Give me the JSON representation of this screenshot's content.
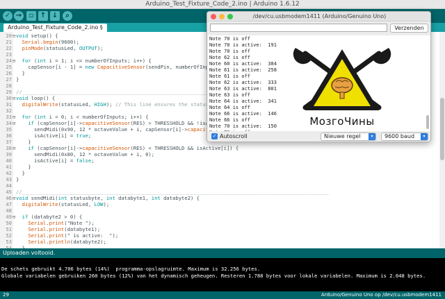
{
  "ide": {
    "title": "Arduino_Test_Fixture_Code_2.ino | Arduino 1.6.12",
    "toolbar_icons": [
      "verify-icon",
      "upload-icon",
      "new-icon",
      "open-icon",
      "save-icon",
      "serial-monitor-icon"
    ],
    "tab_label": "Arduino_Test_Fixture_Code_2.ino §",
    "code_lines": [
      {
        "n": "20",
        "fold": "⊟",
        "text": "void setup() {"
      },
      {
        "n": "21",
        "fold": "",
        "text": "  Serial.begin(9600);"
      },
      {
        "n": "22",
        "fold": "",
        "text": "  pinMode(statusLed, OUTPUT);"
      },
      {
        "n": "23",
        "fold": "",
        "text": ""
      },
      {
        "n": "24",
        "fold": "⊟",
        "text": "  for (int i = 1; i <= numberOfInputs; i++) {"
      },
      {
        "n": "25",
        "fold": "",
        "text": "    capSensor[i - 1] = new CapacitiveSensor(sendPin, numberOfInputs + first"
      },
      {
        "n": "26",
        "fold": "",
        "text": "  }"
      },
      {
        "n": "27",
        "fold": "",
        "text": "}"
      },
      {
        "n": "28",
        "fold": "",
        "text": ""
      },
      {
        "n": "29",
        "fold": "",
        "text": "//______________________________________________________________________________________________________"
      },
      {
        "n": "30",
        "fold": "⊟",
        "text": "void loop() {"
      },
      {
        "n": "31",
        "fold": "",
        "text": "  digitalWrite(statusLed, HIGH); // This line ensures the status LED gets "
      },
      {
        "n": "32",
        "fold": "",
        "text": ""
      },
      {
        "n": "33",
        "fold": "⊟",
        "text": "  for (int i = 0; i < numberOfInputs; i++) {"
      },
      {
        "n": "34",
        "fold": "⊟",
        "text": "    if (capSensor[i]->capacitiveSensor(RES) > THRESSHOLD && !isActive[i] )"
      },
      {
        "n": "35",
        "fold": "",
        "text": "      sendMidi(0x90, 12 * octaveValue + i, capSensor[i]->capacitiveSensor(R"
      },
      {
        "n": "36",
        "fold": "",
        "text": "      isActive[i] = true;"
      },
      {
        "n": "37",
        "fold": "",
        "text": "    }"
      },
      {
        "n": "38",
        "fold": "⊟",
        "text": "    if (capSensor[i]->capacitiveSensor(RES) < THRESSHOLD && isActive[i]) {"
      },
      {
        "n": "39",
        "fold": "",
        "text": "      sendMidi(0x80, 12 * octaveValue + i, 0);"
      },
      {
        "n": "40",
        "fold": "",
        "text": "      isActive[i] = false;"
      },
      {
        "n": "41",
        "fold": "",
        "text": "    }"
      },
      {
        "n": "42",
        "fold": "",
        "text": "  }"
      },
      {
        "n": "43",
        "fold": "",
        "text": "}"
      },
      {
        "n": "44",
        "fold": "",
        "text": ""
      },
      {
        "n": "45",
        "fold": "",
        "text": "//______________________________________________________________________________________________________"
      },
      {
        "n": "46",
        "fold": "⊟",
        "text": "void sendMidi(int statusbyte, int databyte1, int databyte2) {"
      },
      {
        "n": "47",
        "fold": "",
        "text": "  digitalWrite(statusLed, LOW);"
      },
      {
        "n": "48",
        "fold": "",
        "text": ""
      },
      {
        "n": "49",
        "fold": "⊟",
        "text": "  if (databyte2 > 0) {"
      },
      {
        "n": "50",
        "fold": "",
        "text": "    Serial.print(\"Note \");"
      },
      {
        "n": "51",
        "fold": "",
        "text": "    Serial.print(databyte1);"
      },
      {
        "n": "52",
        "fold": "",
        "text": "    Serial.print(\" is active:  \");"
      },
      {
        "n": "53",
        "fold": "",
        "text": "    Serial.println(databyte2);"
      },
      {
        "n": "54",
        "fold": "",
        "text": "  }"
      },
      {
        "n": "55",
        "fold": "",
        "text": "  else {"
      }
    ],
    "status_text": "Uploaden voltooid.",
    "console_lines": [
      "De schets gebruikt 4.706 bytes (14%)  programma-opslagruimte. Maximum is 32.256 bytes.",
      "Globale variabelen gebruiken 260 bytes (12%) van het dynamisch geheugen. Resteren 1.788 bytes voor lokale variabelen. Maximum is 2.048 bytes."
    ],
    "footer_line": "29",
    "footer_board": "Arduino/Genuino Uno op /dev/cu.usbmodem1411"
  },
  "serial_monitor": {
    "title": "/dev/cu.usbmodem1411 (Arduino/Genuino Uno)",
    "input_value": "",
    "send_label": "Verzenden",
    "output_lines": [
      "Note 70 is off",
      "Note 70 is active:  191",
      "Note 70 is off",
      "Note 62 is off",
      "Note 60 is active:  384",
      "Note 61 is active:  258",
      "Note 61 is off",
      "Note 62 is active:  333",
      "Note 63 is active:  801",
      "Note 63 is off",
      "Note 64 is active:  341",
      "Note 64 is off",
      "Note 66 is active:  146",
      "Note 66 is off",
      "Note 70 is active:  150",
      "Note 70 is off"
    ],
    "logo_text": "МозгоЧины",
    "autoscroll_label": "Autoscroll",
    "autoscroll_checked": true,
    "line_ending": "Nieuwe regel",
    "baud_rate": "9600 baud"
  },
  "colors": {
    "teal_dark": "#006468",
    "teal_tab": "#17a1a5",
    "keyword": "#00979c",
    "function": "#d35400",
    "logo_yellow": "#f0e000"
  }
}
